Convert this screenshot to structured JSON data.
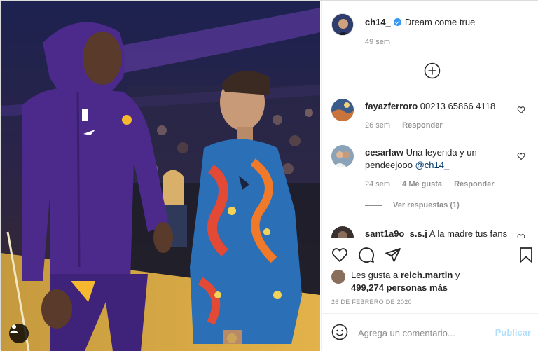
{
  "post": {
    "owner": {
      "username": "ch14_",
      "verified": true,
      "caption": "Dream come true",
      "caption_time": "49 sem"
    },
    "comments": [
      {
        "username": "fayazferroro",
        "text": "00213 65866 4118",
        "mention": "",
        "time": "26 sem",
        "likes": "",
        "reply": "Responder"
      },
      {
        "username": "cesarlaw",
        "text": "Una leyenda y un pendeejooo",
        "mention": "@ch14_",
        "time": "24 sem",
        "likes": "4 Me gusta",
        "reply": "Responder"
      },
      {
        "username": "sant1a9o_s.s.j",
        "text": "A la madre tus fans",
        "mention": "",
        "time": "",
        "likes": "",
        "reply": ""
      }
    ],
    "view_replies": "Ver respuestas (1)",
    "likes": {
      "prefix": "Les gusta a",
      "user": "reich.martin",
      "connector": "y",
      "count": "499,274 personas más"
    },
    "date": "26 DE FEBRERO DE 2020",
    "add_comment": {
      "placeholder": "Agrega un comentario...",
      "publish_label": "Publicar"
    }
  },
  "colors": {
    "accent_blue": "#3897f0",
    "publish_disabled": "#b2dffc",
    "lakers_purple": "#4b2a8c",
    "muted": "#8e8e8e"
  },
  "icons": {
    "load_more": "plus-circle-icon",
    "heart": "heart-icon",
    "comment": "comment-icon",
    "share": "paper-plane-icon",
    "save": "bookmark-icon",
    "emoji": "smiley-icon",
    "tag": "user-tag-icon"
  }
}
